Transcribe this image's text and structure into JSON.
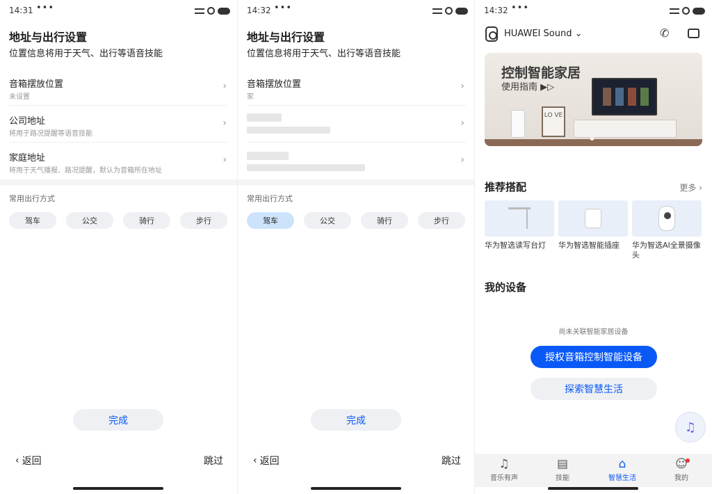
{
  "status": {
    "screen1_time": "14:31",
    "screen2_time": "14:32",
    "screen3_time": "14:32",
    "dots": "•••"
  },
  "settings": {
    "title": "地址与出行设置",
    "subtitle": "位置信息将用于天气、出行等语音技能",
    "speaker_location_label": "音箱摆放位置",
    "speaker_location_value_unset": "未设置",
    "speaker_location_value_set": "家",
    "company_label": "公司地址",
    "company_desc": "将用于路况提醒等语音技能",
    "home_label": "家庭地址",
    "home_desc": "将用于天气播报、路况提醒，默认为音箱所在地址",
    "travel_title": "常用出行方式",
    "travel_modes": [
      "驾车",
      "公交",
      "骑行",
      "步行"
    ],
    "done": "完成",
    "back": "返回",
    "skip": "跳过"
  },
  "smart_life": {
    "device_name": "HUAWEI Sound",
    "banner_title": "控制智能家居",
    "banner_subtitle": "使用指南 ▶▷",
    "banner_frame_text": "LO\nVE",
    "recommend_title": "推荐搭配",
    "more": "更多",
    "products": [
      "华为智选读写台灯",
      "华为智选智能插座",
      "华为智选AI全景摄像头"
    ],
    "my_devices_title": "我的设备",
    "empty_text": "尚未关联智能家居设备",
    "authorize_button": "授权音箱控制智能设备",
    "explore_button": "探索智慧生活",
    "tabs": [
      "音乐有声",
      "技能",
      "智慧生活",
      "我的"
    ]
  },
  "colors": {
    "accent": "#0a59f7",
    "selected_chip": "#cde3fb"
  }
}
